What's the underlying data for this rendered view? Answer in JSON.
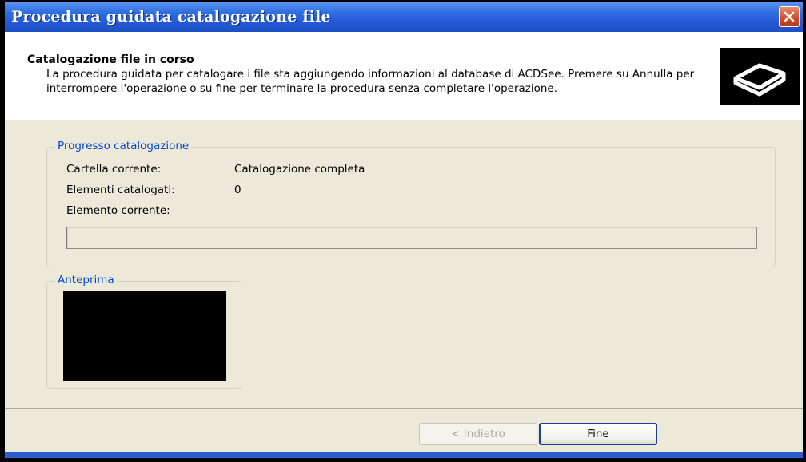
{
  "window": {
    "title": "Procedura guidata catalogazione file",
    "close_icon": "close-icon"
  },
  "header": {
    "title": "Catalogazione file in corso",
    "description": "La procedura guidata per catalogare i file sta aggiungendo informazioni al database di ACDSee. Premere su Annulla per interrompere l'operazione o su fine per terminare la procedura senza completare l'operazione.",
    "logo_icon": "drive-icon"
  },
  "progress": {
    "legend": "Progresso catalogazione",
    "current_folder_label": "Cartella corrente:",
    "current_folder_value": "Catalogazione completa",
    "items_cataloged_label": "Elementi catalogati:",
    "items_cataloged_value": "0",
    "current_item_label": "Elemento corrente:",
    "current_item_value": "",
    "bar_fraction": 0
  },
  "preview": {
    "legend": "Anteprima"
  },
  "buttons": {
    "back_label": "< Indietro",
    "finish_label": "Fine"
  },
  "colors": {
    "titlebar": "#2359d6",
    "legend_text": "#0046d5",
    "dialog_bg": "#ece9d8"
  }
}
